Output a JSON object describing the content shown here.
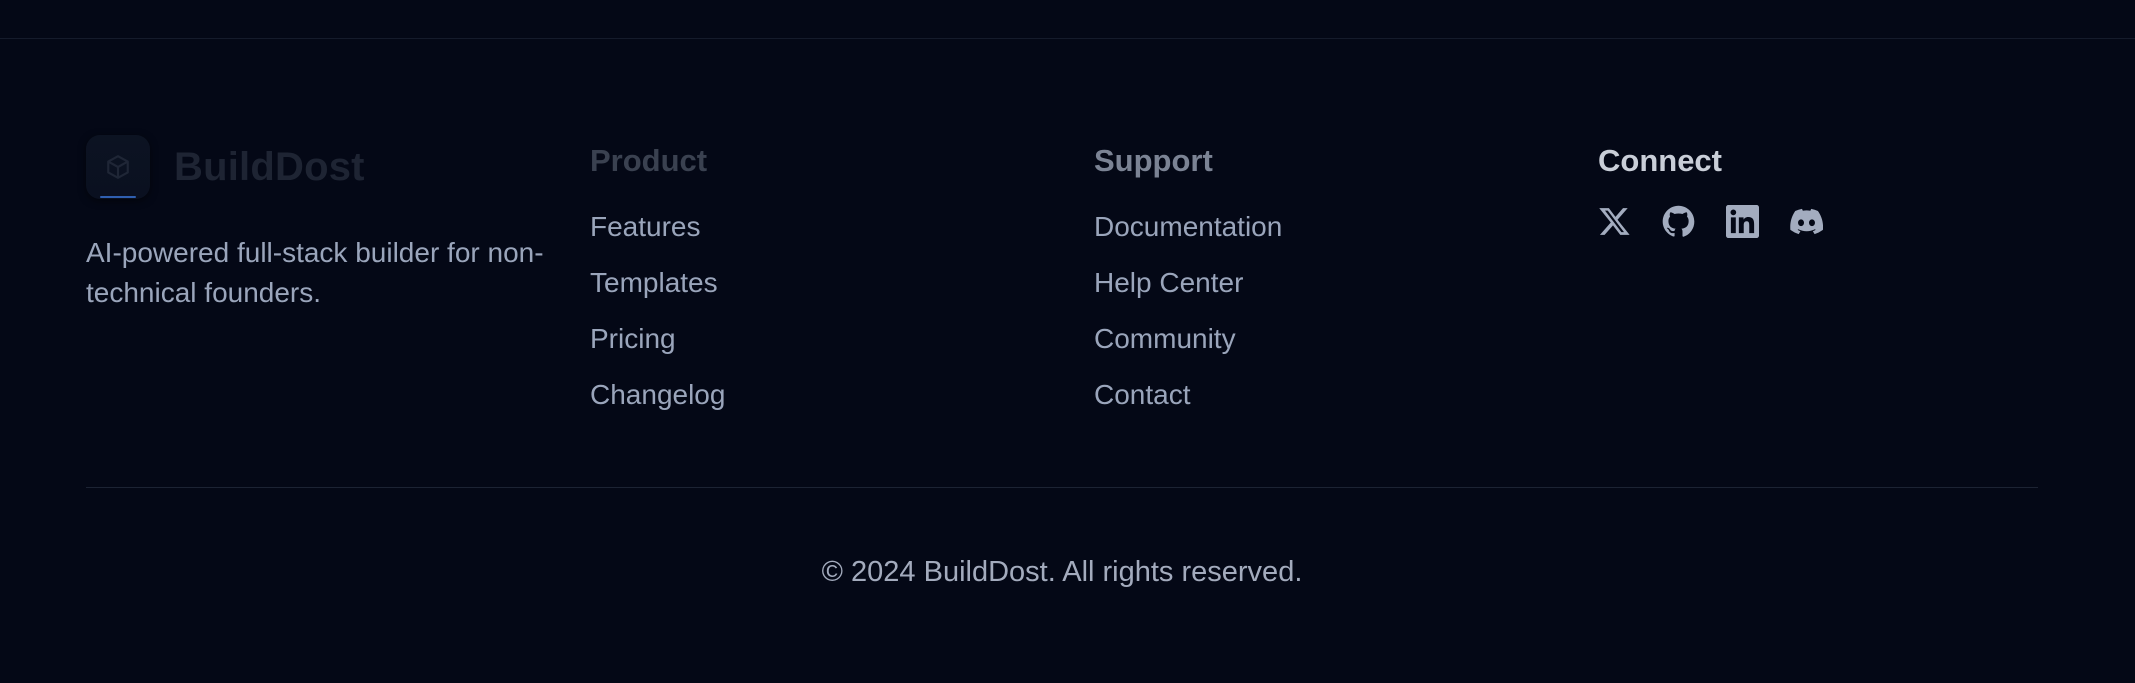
{
  "brand": {
    "name": "BuildDost",
    "tagline": "AI-powered full-stack builder for non-technical founders.",
    "logo_icon": "cube-icon",
    "accent_color": "#2f5fb0"
  },
  "columns": {
    "product": {
      "title": "Product",
      "links": [
        "Features",
        "Templates",
        "Pricing",
        "Changelog"
      ]
    },
    "support": {
      "title": "Support",
      "links": [
        "Documentation",
        "Help Center",
        "Community",
        "Contact"
      ]
    },
    "connect": {
      "title": "Connect",
      "socials": [
        "x-twitter-icon",
        "github-icon",
        "linkedin-icon",
        "discord-icon"
      ]
    }
  },
  "copyright": "© 2024 BuildDost. All rights reserved."
}
